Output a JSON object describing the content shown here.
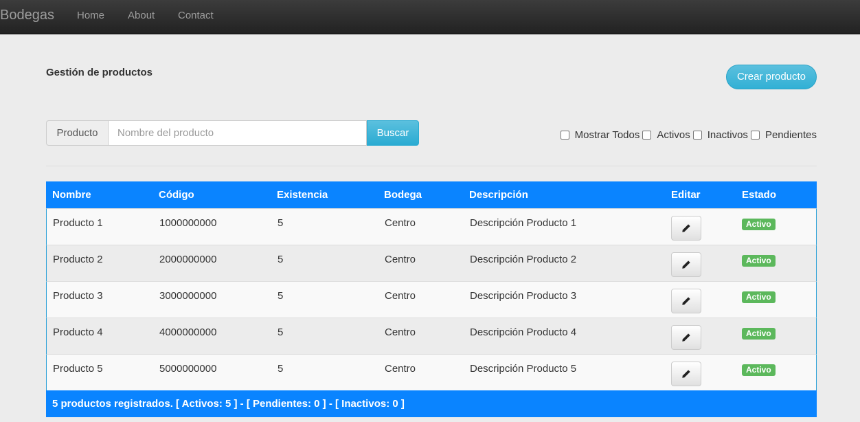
{
  "navbar": {
    "brand": "Bodegas",
    "links": [
      "Home",
      "About",
      "Contact"
    ]
  },
  "page": {
    "title": "Gestión de productos",
    "create_button": "Crear producto"
  },
  "search": {
    "label": "Producto",
    "placeholder": "Nombre del producto",
    "value": "",
    "button": "Buscar"
  },
  "filters": [
    {
      "label": "Mostrar Todos",
      "checked": false
    },
    {
      "label": "Activos",
      "checked": false
    },
    {
      "label": "Inactivos",
      "checked": false
    },
    {
      "label": "Pendientes",
      "checked": false
    }
  ],
  "table": {
    "columns": [
      "Nombre",
      "Código",
      "Existencia",
      "Bodega",
      "Descripción",
      "Editar",
      "Estado"
    ],
    "rows": [
      {
        "nombre": "Producto 1",
        "codigo": "1000000000",
        "existencia": "5",
        "bodega": "Centro",
        "descripcion": "Descripción Producto 1",
        "estado": "Activo"
      },
      {
        "nombre": "Producto 2",
        "codigo": "2000000000",
        "existencia": "5",
        "bodega": "Centro",
        "descripcion": "Descripción Producto 2",
        "estado": "Activo"
      },
      {
        "nombre": "Producto 3",
        "codigo": "3000000000",
        "existencia": "5",
        "bodega": "Centro",
        "descripcion": "Descripción Producto 3",
        "estado": "Activo"
      },
      {
        "nombre": "Producto 4",
        "codigo": "4000000000",
        "existencia": "5",
        "bodega": "Centro",
        "descripcion": "Descripción Producto 4",
        "estado": "Activo"
      },
      {
        "nombre": "Producto 5",
        "codigo": "5000000000",
        "existencia": "5",
        "bodega": "Centro",
        "descripcion": "Descripción Producto 5",
        "estado": "Activo"
      }
    ],
    "footer": "5 productos registrados. [ Activos: 5 ] - [ Pendientes: 0 ] - [ Inactivos: 0 ]",
    "edit_icon": "pencil-icon"
  },
  "colors": {
    "navbar": "#222222",
    "header_blue": "#0a84ff",
    "info_button": "#5bc0de",
    "badge_active": "#5cb85c",
    "page_background": "#ececec"
  }
}
